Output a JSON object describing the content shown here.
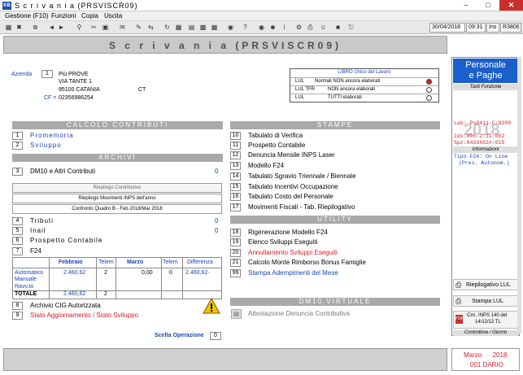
{
  "window": {
    "title": "S c r i v a n i a   (PRSVISCR09)",
    "app_icon": "KB"
  },
  "menu": [
    "Gestione (F10)",
    "Funzioni",
    "Copia",
    "Uscita"
  ],
  "toolbar": {
    "date": "30/04/2018",
    "time": "09:31",
    "ins": "Ins",
    "code": "R3806"
  },
  "header": {
    "title": "S c r i v a n i a   (PRSVISCR09)"
  },
  "azienda": {
    "label": "Azienda",
    "code": "1",
    "name": "Più PROVE",
    "address": "VIA TANTE 1",
    "city": "95100 CATANIA",
    "prov": "CT",
    "cf_label": "CF =",
    "cf": "02356986254"
  },
  "libro": {
    "header": "LIBRO Unico del Lavoro",
    "rows": [
      {
        "a": "LUL",
        "b": "Normali NON ancora elaborati"
      },
      {
        "a": "LUL TFR",
        "b": "NON ancora elaborati"
      },
      {
        "a": "LUL",
        "b": "TUTTI   elaborati"
      }
    ],
    "colors": [
      "#d0202a",
      "#ffffff",
      "#ffffff"
    ]
  },
  "sections": {
    "calcolo": "CALCOLO CONTRIBUTI",
    "archivi": "ARCHIVI",
    "stampe": "STAMPE",
    "utility": "UTILITY",
    "dm10v": "DM10 VIRTUALE"
  },
  "left_items": [
    {
      "n": "1",
      "t": "Promemoria"
    },
    {
      "n": "2",
      "t": "Sviluppo"
    },
    {
      "n": "3",
      "t": "DM10  e  Altri Contributi",
      "v": "0"
    },
    {
      "n": "4",
      "t": "Tributi",
      "v": "0"
    },
    {
      "n": "5",
      "t": "Inail",
      "v": "0"
    },
    {
      "n": "6",
      "t": "Prospetto Contabile"
    },
    {
      "n": "7",
      "t": "F24"
    },
    {
      "n": "8",
      "t": "Archivio CIG Autorizzata"
    },
    {
      "n": "9",
      "t": "Stato Aggiornamento / Stato Sviluppo"
    }
  ],
  "riepilogo": {
    "title": "Riepilogo Contributivo",
    "line1": "Riepilogo Movimenti INPS dell'anno",
    "line2": "Confronto Quadro B  -  Feb 2018/Mar 2018"
  },
  "f24": {
    "cols": [
      "Febbraio",
      "Telem",
      "Marzo",
      "Telem",
      "Differenza"
    ],
    "rows": [
      {
        "l": "Automatico",
        "feb": "2.460,62",
        "t1": "2",
        "mar": "0,00",
        "t2": "0",
        "diff": "2.460,62-"
      },
      {
        "l": "Manuale",
        "feb": "",
        "t1": "",
        "mar": "",
        "t2": "",
        "diff": ""
      },
      {
        "l": "Ravv.to",
        "feb": "",
        "t1": "",
        "mar": "",
        "t2": "",
        "diff": ""
      },
      {
        "l": "TOTALE",
        "feb": "2.460,62",
        "t1": "2",
        "mar": "",
        "t2": "",
        "diff": ""
      }
    ]
  },
  "stampe": [
    {
      "n": "10",
      "t": "Tabulato di Verifica"
    },
    {
      "n": "11",
      "t": "Prospetto Contabile"
    },
    {
      "n": "12",
      "t": "Denuncia Mensile INPS Laser"
    },
    {
      "n": "13",
      "t": "Modello  F24"
    },
    {
      "n": "14",
      "t": "Tabulato Sgravio Triennale / Biennale"
    },
    {
      "n": "15",
      "t": "Tabulato Incentivi Occupazione"
    },
    {
      "n": "16",
      "t": "Tabulato Costo del Personale"
    },
    {
      "n": "17",
      "t": "Movimenti Fiscali - Tab. Riepilogativo"
    }
  ],
  "utility": [
    {
      "n": "18",
      "t": "Rigenerazione Modello F24"
    },
    {
      "n": "19",
      "t": "Elenco      Sviluppi Eseguiti"
    },
    {
      "n": "20",
      "t": "Annullamento Sviluppi Eseguiti"
    },
    {
      "n": "21",
      "t": "Calcolo Monte Rimborso  Bonus Famiglie"
    },
    {
      "n": "99",
      "t": "Stampa  Adempimenti del Mese"
    }
  ],
  "dm10v_item": "Attestazione Denuncia Contributiva",
  "scelta": {
    "label": "Scelta Operazione",
    "value": "0"
  },
  "right": {
    "title1": "Personale",
    "title2": "e Paghe",
    "tasti": "Tasti Funzione",
    "big": "2018",
    "lab1": "Lab: Ps8411-C:8209",
    "lab2": "Idx:005-2:11:002",
    "lab3": "Spz:6433X02#:015",
    "informazioni": "Informazioni",
    "tipo1": "Tipo F24: On Line",
    "tipo2": "(Pres. Autonom.)",
    "btn_riep": "Riepilogativo LUL",
    "btn_stampa": "Stampa  LUL",
    "circ1": "Circ. INPS 140 del",
    "circ2": "14/12/12 TL",
    "controllore": "Controllore / Giorno"
  },
  "mese": {
    "line1": "Marzo      2018",
    "line2": "001 DARIO"
  }
}
